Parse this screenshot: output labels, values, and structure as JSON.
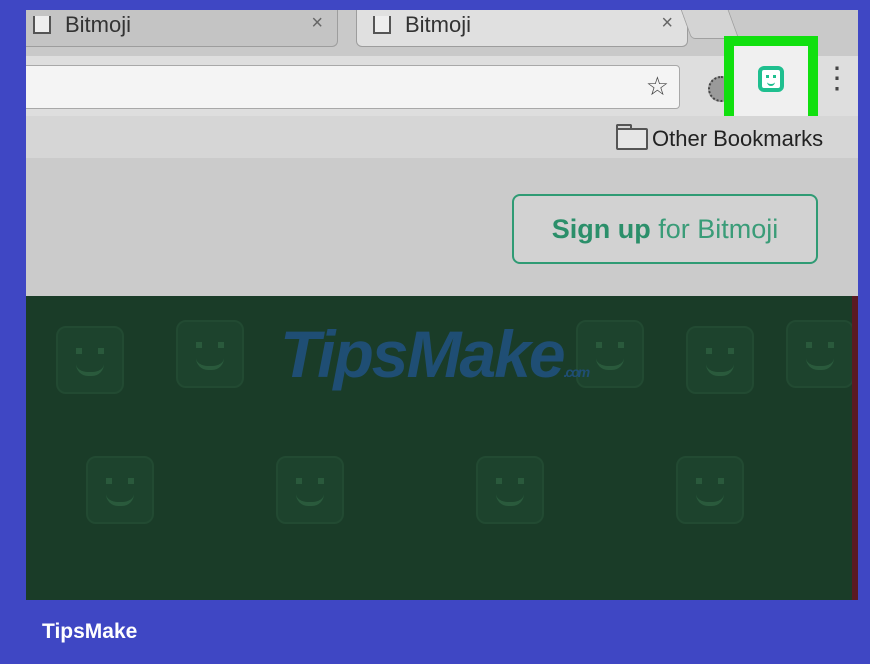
{
  "browser": {
    "tabs": [
      {
        "title": "Bitmoji",
        "close": "×"
      },
      {
        "title": "Bitmoji",
        "close": "×"
      }
    ],
    "star_glyph": "☆",
    "menu_glyph": "⋮",
    "extension_icon": "bitmoji-icon",
    "highlight_color": "#11e00f",
    "bookmarks": {
      "other_label": "Other Bookmarks"
    }
  },
  "page": {
    "signup_strong": "Sign up",
    "signup_rest": " for Bitmoji"
  },
  "watermark": {
    "main": "TipsMake",
    "sub": ".com"
  },
  "footer": {
    "label": "TipsMake"
  }
}
